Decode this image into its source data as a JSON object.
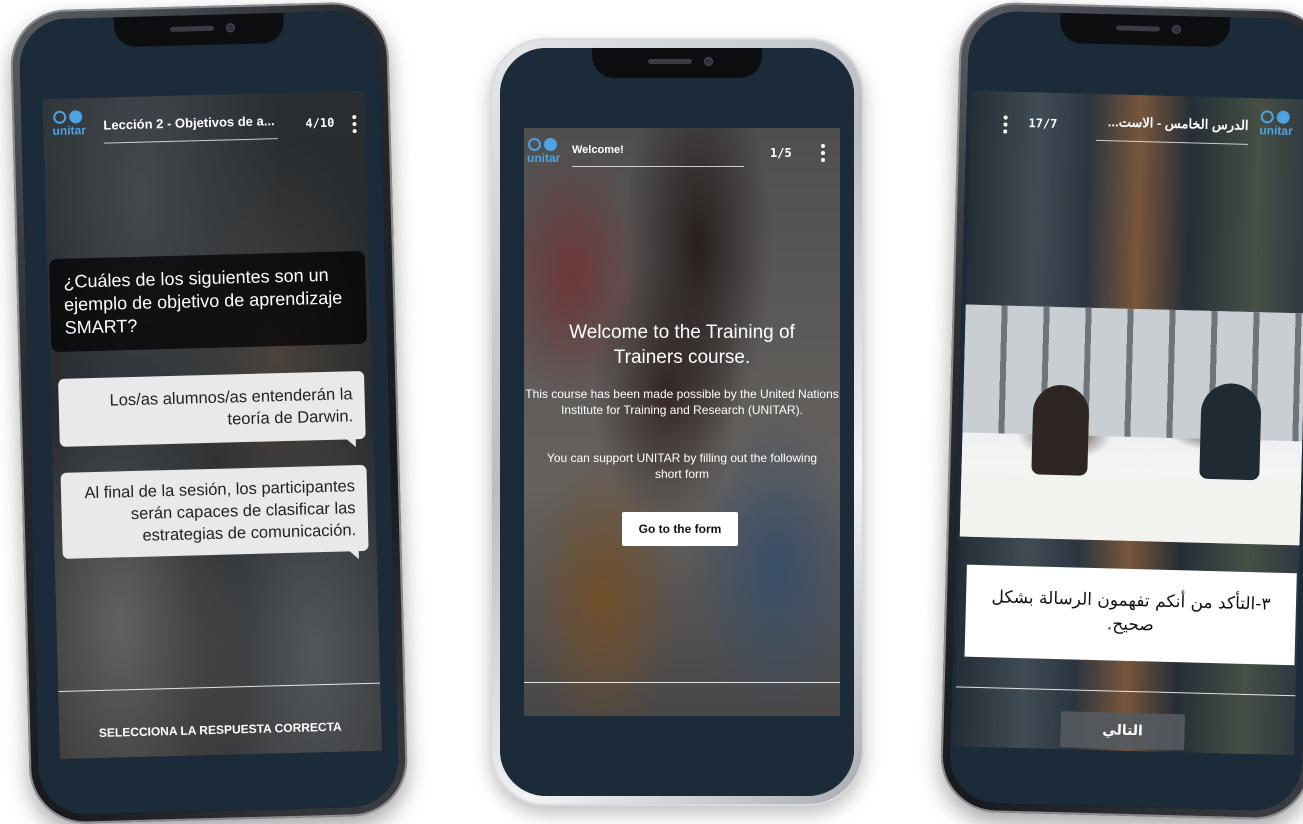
{
  "phone_left": {
    "lesson_title": "Lección 2 - Objetivos de a...",
    "counter": "4/10",
    "question": "¿Cuáles de los siguientes son un ejemplo de objetivo de aprendizaje SMART?",
    "answers": [
      "Los/as alumnos/as entenderán la teoría de Darwin.",
      "Al final de la sesión, los participantes serán capaces de clasificar las estrategias de comunicación."
    ],
    "footer": "SELECCIONA LA RESPUESTA CORRECTA"
  },
  "phone_middle": {
    "lesson_title": "Welcome!",
    "counter": "1/5",
    "heading": "Welcome to the Training of Trainers course.",
    "paragraph1": "This course has been made possible by the United Nations Institute for Training and Research (UNITAR).",
    "paragraph2": "You can support UNITAR by filling out the following short form",
    "button": "Go to the form"
  },
  "phone_right": {
    "lesson_title": "الدرس الخامس - الاست...",
    "counter": "17/7",
    "caption": "٣-التأكد من أنكم تفهمون الرسالة بشكل صحيح.",
    "button": "التالي"
  },
  "brand": {
    "logo_text": "unitar",
    "accent": "#4da3e0"
  }
}
